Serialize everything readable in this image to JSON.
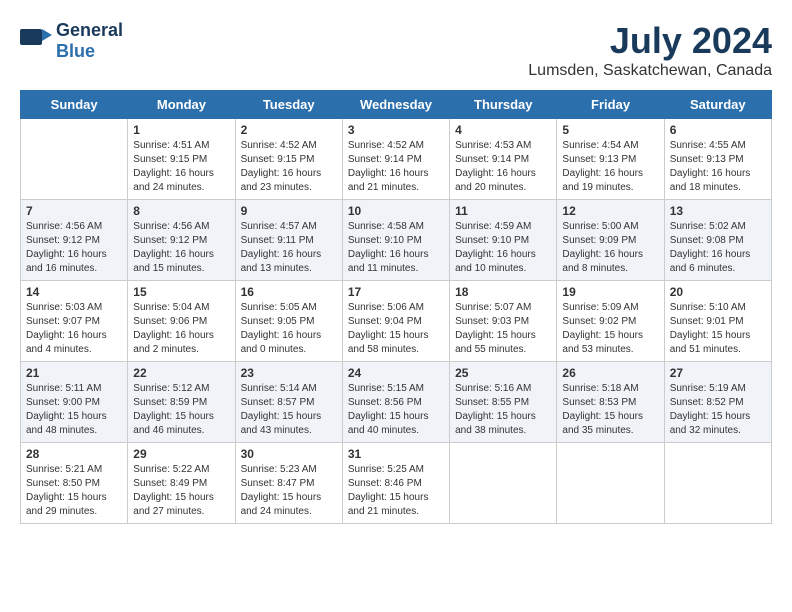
{
  "logo": {
    "line1": "General",
    "line2": "Blue"
  },
  "title": "July 2024",
  "location": "Lumsden, Saskatchewan, Canada",
  "days_of_week": [
    "Sunday",
    "Monday",
    "Tuesday",
    "Wednesday",
    "Thursday",
    "Friday",
    "Saturday"
  ],
  "weeks": [
    [
      {
        "day": "",
        "info": ""
      },
      {
        "day": "1",
        "info": "Sunrise: 4:51 AM\nSunset: 9:15 PM\nDaylight: 16 hours\nand 24 minutes."
      },
      {
        "day": "2",
        "info": "Sunrise: 4:52 AM\nSunset: 9:15 PM\nDaylight: 16 hours\nand 23 minutes."
      },
      {
        "day": "3",
        "info": "Sunrise: 4:52 AM\nSunset: 9:14 PM\nDaylight: 16 hours\nand 21 minutes."
      },
      {
        "day": "4",
        "info": "Sunrise: 4:53 AM\nSunset: 9:14 PM\nDaylight: 16 hours\nand 20 minutes."
      },
      {
        "day": "5",
        "info": "Sunrise: 4:54 AM\nSunset: 9:13 PM\nDaylight: 16 hours\nand 19 minutes."
      },
      {
        "day": "6",
        "info": "Sunrise: 4:55 AM\nSunset: 9:13 PM\nDaylight: 16 hours\nand 18 minutes."
      }
    ],
    [
      {
        "day": "7",
        "info": "Sunrise: 4:56 AM\nSunset: 9:12 PM\nDaylight: 16 hours\nand 16 minutes."
      },
      {
        "day": "8",
        "info": "Sunrise: 4:56 AM\nSunset: 9:12 PM\nDaylight: 16 hours\nand 15 minutes."
      },
      {
        "day": "9",
        "info": "Sunrise: 4:57 AM\nSunset: 9:11 PM\nDaylight: 16 hours\nand 13 minutes."
      },
      {
        "day": "10",
        "info": "Sunrise: 4:58 AM\nSunset: 9:10 PM\nDaylight: 16 hours\nand 11 minutes."
      },
      {
        "day": "11",
        "info": "Sunrise: 4:59 AM\nSunset: 9:10 PM\nDaylight: 16 hours\nand 10 minutes."
      },
      {
        "day": "12",
        "info": "Sunrise: 5:00 AM\nSunset: 9:09 PM\nDaylight: 16 hours\nand 8 minutes."
      },
      {
        "day": "13",
        "info": "Sunrise: 5:02 AM\nSunset: 9:08 PM\nDaylight: 16 hours\nand 6 minutes."
      }
    ],
    [
      {
        "day": "14",
        "info": "Sunrise: 5:03 AM\nSunset: 9:07 PM\nDaylight: 16 hours\nand 4 minutes."
      },
      {
        "day": "15",
        "info": "Sunrise: 5:04 AM\nSunset: 9:06 PM\nDaylight: 16 hours\nand 2 minutes."
      },
      {
        "day": "16",
        "info": "Sunrise: 5:05 AM\nSunset: 9:05 PM\nDaylight: 16 hours\nand 0 minutes."
      },
      {
        "day": "17",
        "info": "Sunrise: 5:06 AM\nSunset: 9:04 PM\nDaylight: 15 hours\nand 58 minutes."
      },
      {
        "day": "18",
        "info": "Sunrise: 5:07 AM\nSunset: 9:03 PM\nDaylight: 15 hours\nand 55 minutes."
      },
      {
        "day": "19",
        "info": "Sunrise: 5:09 AM\nSunset: 9:02 PM\nDaylight: 15 hours\nand 53 minutes."
      },
      {
        "day": "20",
        "info": "Sunrise: 5:10 AM\nSunset: 9:01 PM\nDaylight: 15 hours\nand 51 minutes."
      }
    ],
    [
      {
        "day": "21",
        "info": "Sunrise: 5:11 AM\nSunset: 9:00 PM\nDaylight: 15 hours\nand 48 minutes."
      },
      {
        "day": "22",
        "info": "Sunrise: 5:12 AM\nSunset: 8:59 PM\nDaylight: 15 hours\nand 46 minutes."
      },
      {
        "day": "23",
        "info": "Sunrise: 5:14 AM\nSunset: 8:57 PM\nDaylight: 15 hours\nand 43 minutes."
      },
      {
        "day": "24",
        "info": "Sunrise: 5:15 AM\nSunset: 8:56 PM\nDaylight: 15 hours\nand 40 minutes."
      },
      {
        "day": "25",
        "info": "Sunrise: 5:16 AM\nSunset: 8:55 PM\nDaylight: 15 hours\nand 38 minutes."
      },
      {
        "day": "26",
        "info": "Sunrise: 5:18 AM\nSunset: 8:53 PM\nDaylight: 15 hours\nand 35 minutes."
      },
      {
        "day": "27",
        "info": "Sunrise: 5:19 AM\nSunset: 8:52 PM\nDaylight: 15 hours\nand 32 minutes."
      }
    ],
    [
      {
        "day": "28",
        "info": "Sunrise: 5:21 AM\nSunset: 8:50 PM\nDaylight: 15 hours\nand 29 minutes."
      },
      {
        "day": "29",
        "info": "Sunrise: 5:22 AM\nSunset: 8:49 PM\nDaylight: 15 hours\nand 27 minutes."
      },
      {
        "day": "30",
        "info": "Sunrise: 5:23 AM\nSunset: 8:47 PM\nDaylight: 15 hours\nand 24 minutes."
      },
      {
        "day": "31",
        "info": "Sunrise: 5:25 AM\nSunset: 8:46 PM\nDaylight: 15 hours\nand 21 minutes."
      },
      {
        "day": "",
        "info": ""
      },
      {
        "day": "",
        "info": ""
      },
      {
        "day": "",
        "info": ""
      }
    ]
  ]
}
